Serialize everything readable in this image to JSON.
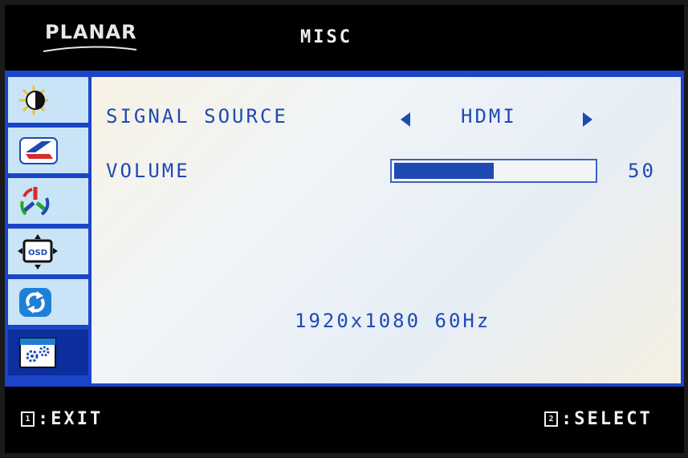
{
  "header": {
    "brand": "PLANAR",
    "title": "MISC"
  },
  "sidebar": {
    "items": [
      {
        "name": "brightness-contrast",
        "icon": "brightness-contrast-icon",
        "active": false
      },
      {
        "name": "image-geometry",
        "icon": "geometry-icon",
        "active": false
      },
      {
        "name": "color",
        "icon": "color-rgb-icon",
        "active": false
      },
      {
        "name": "osd-settings",
        "icon": "osd-icon",
        "active": false
      },
      {
        "name": "reset",
        "icon": "reset-icon",
        "active": false
      },
      {
        "name": "misc",
        "icon": "misc-gear-icon",
        "active": true
      }
    ]
  },
  "misc": {
    "signal_source_label": "SIGNAL SOURCE",
    "signal_source_value": "HDMI",
    "volume_label": "VOLUME",
    "volume_value": "50",
    "volume_fraction": 0.5,
    "resolution": "1920x1080 60Hz"
  },
  "footer": {
    "exit_key": "1",
    "exit_label": ":EXIT",
    "select_key": "2",
    "select_label": ":SELECT"
  },
  "colors": {
    "accent": "#1f4ab3",
    "frame_blue": "#1b45c9",
    "sidebar_bg": "#c9e4f6",
    "sidebar_active": "#0d2f9e"
  }
}
